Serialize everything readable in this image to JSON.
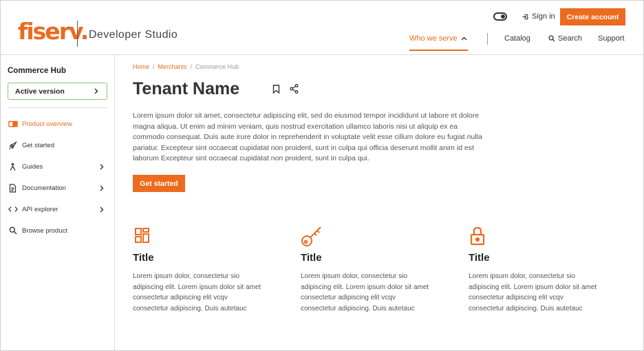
{
  "colors": {
    "accent": "#ec6b1f",
    "version_border": "#8fc37a"
  },
  "header": {
    "logo": "fiserv.",
    "studio": "Developer Studio",
    "sign_in": "Sign in",
    "create_account": "Create account",
    "nav": {
      "who_we_serve": "Who we serve",
      "catalog": "Catalog",
      "search": "Search",
      "support": "Support"
    }
  },
  "sidebar": {
    "title": "Commerce Hub",
    "version_label": "Active version",
    "items": [
      {
        "label": "Product overview",
        "icon": "book-icon"
      },
      {
        "label": "Get started",
        "icon": "rocket-icon"
      },
      {
        "label": "Guides",
        "icon": "merge-icon"
      },
      {
        "label": "Documentation",
        "icon": "document-icon"
      },
      {
        "label": "API explorer",
        "icon": "code-icon"
      },
      {
        "label": "Browse product",
        "icon": "search-icon"
      }
    ]
  },
  "breadcrumb": {
    "home": "Home",
    "merchants": "Merchants",
    "current": "Commerce Hub",
    "sep": "/"
  },
  "main": {
    "title": "Tenant Name",
    "description": "Lorem ipsum dolor sit amet, consectetur adipiscing elit, sed do eiusmod tempor incididunt ut labore et dolore magna aliqua. Ut enim ad minim veniam, quis nostrud exercitation ullamco laboris nisi ut aliquip ex ea commodo consequat. Duis aute irure dolor in reprehenderit in voluptate velit esse cillum dolore eu fugiat nulla pariatur. Excepteur sint occaecat cupidatat non proident, sunt in culpa qui officia deserunt mollit anim id est laborum Excepteur sint occaecat cupidatat non proident, sunt in culpa qui.",
    "cta": "Get started",
    "features": [
      {
        "icon": "dashboard-icon",
        "title": "Title",
        "text": "Lorem ipsum dolor, consectetur sio adipiscing elit. Lorem ipsum dolor sit amet consectetur adipiscing elit vcqv consectetur adipiscing. Duis autetauc"
      },
      {
        "icon": "key-icon",
        "title": "Title",
        "text": "Lorem ipsum dolor, consectetur sio adipiscing elit. Lorem ipsum dolor sit amet consectetur adipiscing elit vcqv consectetur adipiscing. Duis autetauc"
      },
      {
        "icon": "lock-icon",
        "title": "Title",
        "text": "Lorem ipsum dolor, consectetur sio adipiscing elit. Lorem ipsum dolor sit amet consectetur adipiscing elit vcqv consectetur adipiscing. Duis autetauc"
      }
    ]
  }
}
